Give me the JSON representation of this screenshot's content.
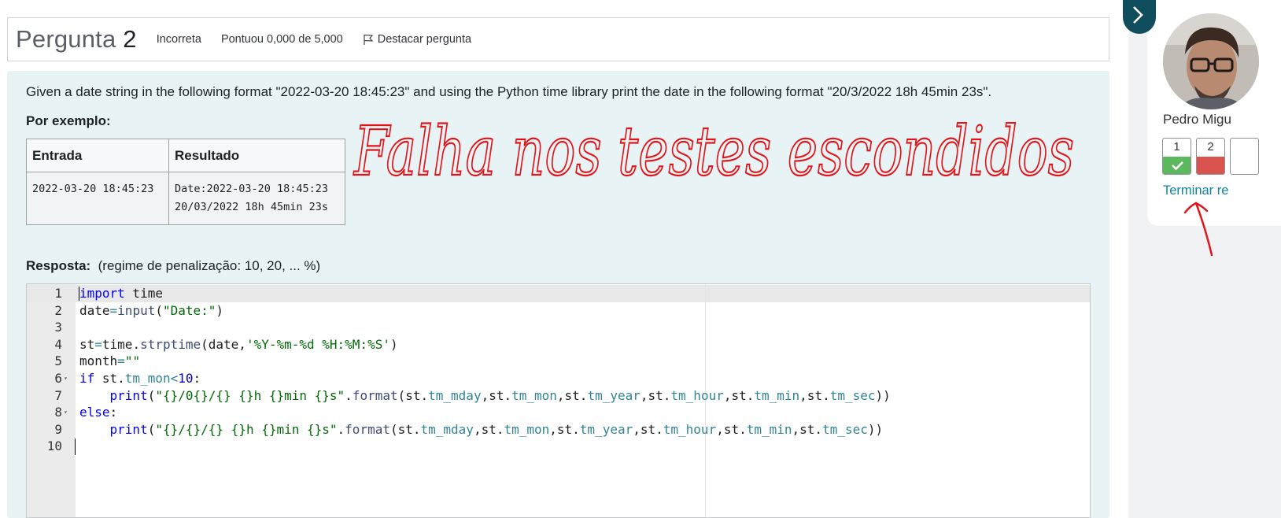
{
  "question": {
    "title_word": "Pergunta",
    "number": "2",
    "status": "Incorreta",
    "grade": "Pontuou 0,000 de 5,000",
    "flag_label": "Destacar pergunta",
    "text": "Given a date string in the following format \"2022-03-20 18:45:23\" and using the Python time library print the date in the following format \"20/3/2022 18h 45min 23s\".",
    "example_heading": "Por exemplo:",
    "example_table": {
      "headers": [
        "Entrada",
        "Resultado"
      ],
      "input": "2022-03-20 18:45:23",
      "result_lines": [
        "Date:2022-03-20 18:45:23",
        "20/03/2022 18h 45min 23s"
      ]
    },
    "answer_label": "Resposta:",
    "answer_note": "(regime de penalização: 10, 20, ... %)"
  },
  "editor": {
    "line_numbers": [
      "1",
      "2",
      "3",
      "4",
      "5",
      "6",
      "7",
      "8",
      "9",
      "10"
    ],
    "fold_markers": [
      "",
      "",
      "",
      "",
      "",
      "▾",
      "",
      "▾",
      "",
      ""
    ]
  },
  "sidebar": {
    "user_name": "Pedro Migu",
    "nav_buttons": [
      {
        "label": "1",
        "status": "correct",
        "color": "#5cb85c"
      },
      {
        "label": "2",
        "status": "incorrect",
        "color": "#d9534f"
      }
    ],
    "finish_link": "Terminar re"
  },
  "annotation": {
    "handwritten_text": "Falha nos testes escondidos",
    "color": "#e0161b"
  },
  "colors": {
    "content_bg": "#e7f3f5",
    "drawer_toggle": "#0f4c5c",
    "link": "#0f83a3"
  }
}
